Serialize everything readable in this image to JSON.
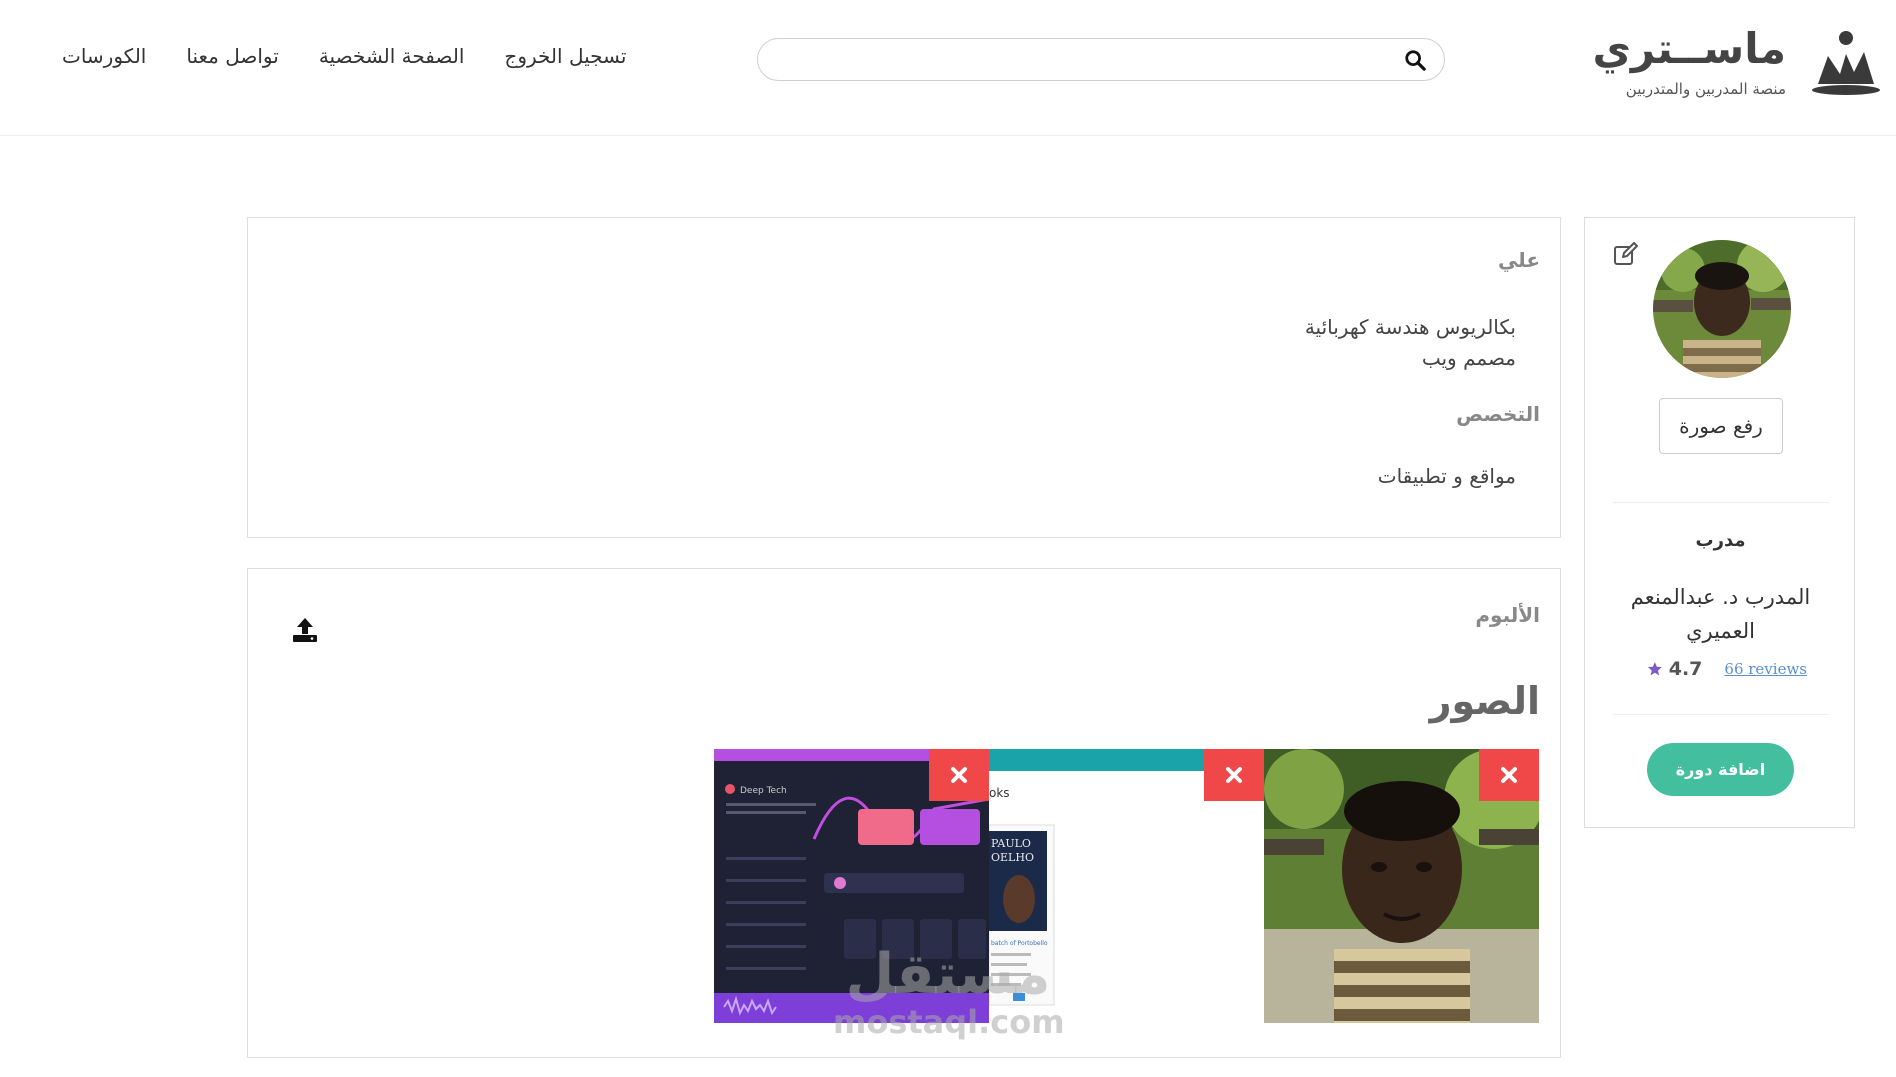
{
  "header": {
    "logo_title": "ماســتري",
    "logo_subtitle": "منصة المدربين والمتدربين",
    "search_placeholder": "",
    "nav": [
      "الكورسات",
      "تواصل معنا",
      "الصفحة الشخصية",
      "تسجيل الخروج"
    ]
  },
  "profile": {
    "upload_label": "رفع صورة",
    "role": "مدرب",
    "name": "المدرب د. عبدالمنعم العميري",
    "rating": "4.7",
    "reviews": "66 reviews",
    "add_course_label": "اضافة دورة",
    "accent_color": "#43bfa0",
    "star_color": "#7d5bc6"
  },
  "info": {
    "name": "علي",
    "lines": [
      "بكالريوس هندسة كهربائية",
      "مصمم ويب"
    ],
    "specialty_label": "التخصص",
    "specialty": "مواقع و تطبيقات"
  },
  "album": {
    "label": "الألبوم",
    "title": "الصور",
    "photos": [
      {
        "kind": "portrait-photo"
      },
      {
        "kind": "books-app-screenshot"
      },
      {
        "kind": "music-app-screenshot"
      }
    ],
    "delete_color": "#f04848"
  },
  "watermark": {
    "line1": "مستقل",
    "line2": "mostaql.com"
  }
}
